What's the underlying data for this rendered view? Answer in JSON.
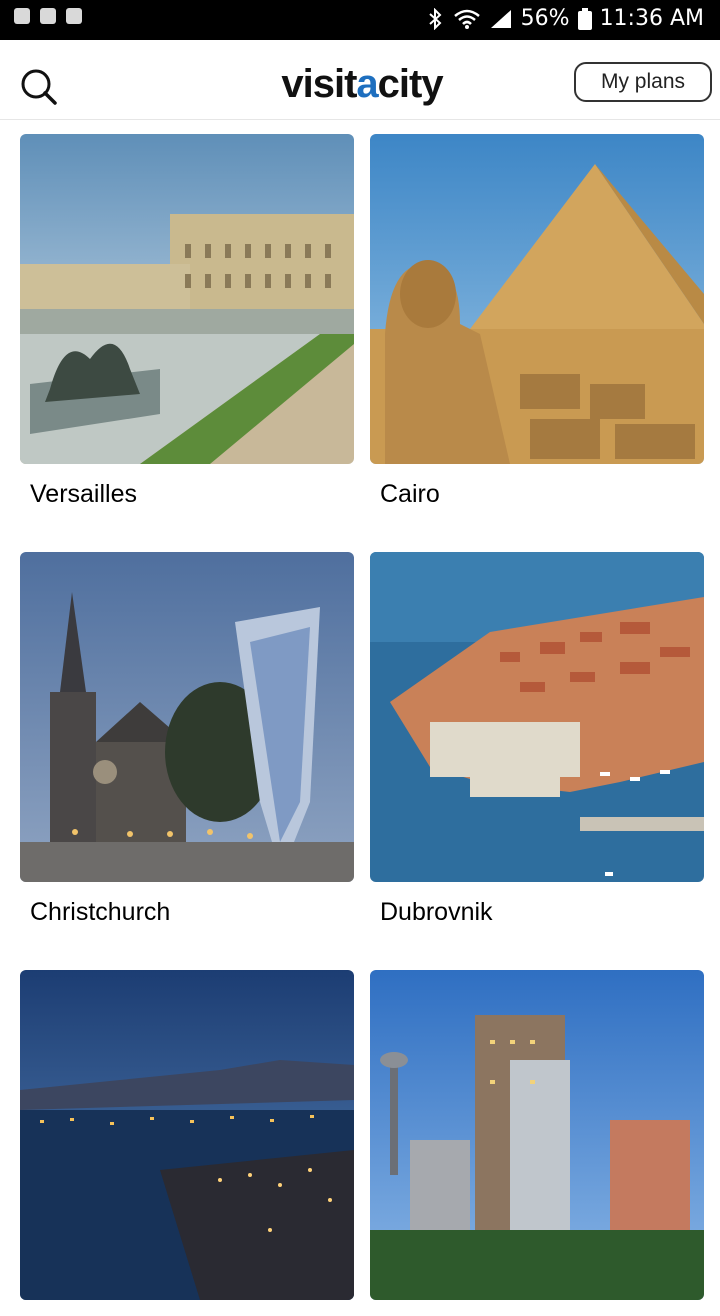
{
  "status_bar": {
    "battery": "56%",
    "time": "11:36 AM"
  },
  "header": {
    "search_icon": "search-icon",
    "logo_text_1": "visit",
    "logo_text_a": "a",
    "logo_text_2": "city",
    "my_plans_label": "My plans"
  },
  "destinations": [
    {
      "name": "Versailles"
    },
    {
      "name": "Cairo"
    },
    {
      "name": "Christchurch"
    },
    {
      "name": "Dubrovnik"
    },
    {
      "name": ""
    },
    {
      "name": ""
    }
  ]
}
